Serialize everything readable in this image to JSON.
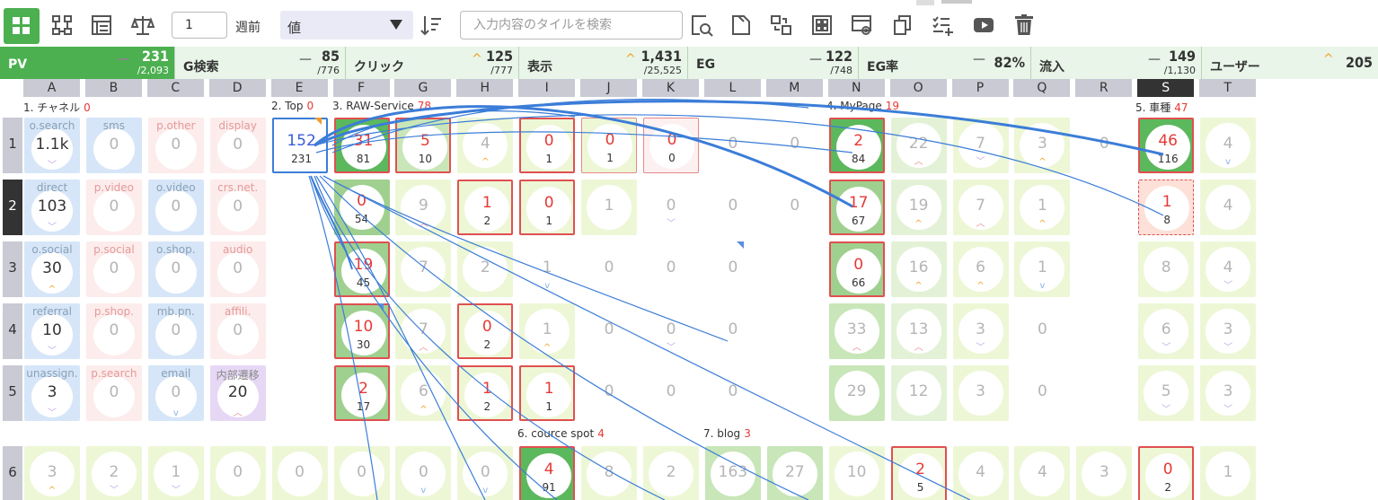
{
  "toolbar": {
    "weeks_value": "1",
    "weeks_label": "週前",
    "metric_select": "値",
    "search_placeholder": "入力内容のタイルを検索",
    "icons": [
      "grid-icon",
      "hierarchy-icon",
      "list-icon",
      "balance-icon",
      "sort-icon",
      "find-icon",
      "document-icon",
      "transfer-icon",
      "tiles-icon",
      "preview-icon",
      "copy-icon",
      "add-checklist-icon",
      "video-icon",
      "trash-icon"
    ]
  },
  "metrics": [
    {
      "label": "PV",
      "value": "231",
      "total": "/2,093",
      "trend": "flat"
    },
    {
      "label": "G検索",
      "value": "85",
      "total": "/776",
      "trend": "flat"
    },
    {
      "label": "クリック",
      "value": "125",
      "total": "/777",
      "trend": "up"
    },
    {
      "label": "表示",
      "value": "1,431",
      "total": "/25,525",
      "trend": "up"
    },
    {
      "label": "EG",
      "value": "122",
      "total": "/748",
      "trend": "flat"
    },
    {
      "label": "EG率",
      "value": "82%",
      "total": "",
      "trend": "flat"
    },
    {
      "label": "流入",
      "value": "149",
      "total": "/1,130",
      "trend": "flat"
    },
    {
      "label": "ユーザー",
      "value": "205",
      "total": "",
      "trend": "up"
    }
  ],
  "columns": [
    "A",
    "B",
    "C",
    "D",
    "E",
    "F",
    "G",
    "H",
    "I",
    "J",
    "K",
    "L",
    "M",
    "N",
    "O",
    "P",
    "Q",
    "R",
    "S",
    "T"
  ],
  "active_column": "S",
  "rows": [
    "1",
    "2",
    "3",
    "4",
    "5",
    "6"
  ],
  "active_row": "2",
  "groups": [
    {
      "name": "1. チャネル",
      "count": "0"
    },
    {
      "name": "2. Top",
      "count": "0"
    },
    {
      "name": "3. RAW-Service",
      "count": "78"
    },
    {
      "name": "4. MyPage",
      "count": "19"
    },
    {
      "name": "5. 車種",
      "count": "47"
    },
    {
      "name": "6. cource spot",
      "count": "4"
    },
    {
      "name": "7. blog",
      "count": "3"
    }
  ],
  "colors": {
    "accent_green": "#4caf50",
    "alert_red": "#e53935",
    "link_blue": "#3b7dd8"
  },
  "cells": [
    {
      "col": 0,
      "row": 0,
      "title": "o.search",
      "value": "1.1k",
      "bg": "blue",
      "caret": "dn2"
    },
    {
      "col": 1,
      "row": 0,
      "title": "sms",
      "value": "0",
      "bg": "blue",
      "faded": true
    },
    {
      "col": 2,
      "row": 0,
      "title": "p.other",
      "value": "0",
      "bg": "pink",
      "faded": true
    },
    {
      "col": 3,
      "row": 0,
      "title": "display",
      "value": "0",
      "bg": "pink",
      "faded": true
    },
    {
      "col": 0,
      "row": 1,
      "title": "direct",
      "value": "103",
      "bg": "blue",
      "caret": "dn2"
    },
    {
      "col": 1,
      "row": 1,
      "title": "p.video",
      "value": "0",
      "bg": "pink",
      "faded": true
    },
    {
      "col": 2,
      "row": 1,
      "title": "o.video",
      "value": "0",
      "bg": "blue",
      "faded": true
    },
    {
      "col": 3,
      "row": 1,
      "title": "crs.net.",
      "value": "0",
      "bg": "pink",
      "faded": true
    },
    {
      "col": 0,
      "row": 2,
      "title": "o.social",
      "value": "30",
      "bg": "blue",
      "caret": "up"
    },
    {
      "col": 1,
      "row": 2,
      "title": "p.social",
      "value": "0",
      "bg": "pink",
      "faded": true
    },
    {
      "col": 2,
      "row": 2,
      "title": "o.shop.",
      "value": "0",
      "bg": "blue",
      "faded": true
    },
    {
      "col": 3,
      "row": 2,
      "title": "audio",
      "value": "0",
      "bg": "pink",
      "faded": true
    },
    {
      "col": 0,
      "row": 3,
      "title": "referral",
      "value": "10",
      "bg": "blue",
      "caret": "dn2"
    },
    {
      "col": 1,
      "row": 3,
      "title": "p.shop.",
      "value": "0",
      "bg": "pink",
      "faded": true
    },
    {
      "col": 2,
      "row": 3,
      "title": "mb.pn.",
      "value": "0",
      "bg": "blue",
      "faded": true
    },
    {
      "col": 3,
      "row": 3,
      "title": "affili.",
      "value": "0",
      "bg": "pink",
      "faded": true
    },
    {
      "col": 0,
      "row": 4,
      "title": "unassign.",
      "value": "3",
      "bg": "blue",
      "caret": "dn2"
    },
    {
      "col": 1,
      "row": 4,
      "title": "p.search",
      "value": "0",
      "bg": "pink",
      "faded": true
    },
    {
      "col": 2,
      "row": 4,
      "title": "email",
      "value": "0",
      "bg": "blue",
      "caret": "dn",
      "faded": true
    },
    {
      "col": 3,
      "row": 4,
      "title": "内部遷移",
      "value": "20",
      "bg": "purple",
      "caret": "up2"
    },
    {
      "col": 4,
      "row": 0,
      "value": "152",
      "sub": "231",
      "bg": "white",
      "border": "blue",
      "valclass": "blue"
    },
    {
      "col": 5,
      "row": 0,
      "value": "31",
      "sub": "81",
      "bg": "green",
      "border": "red",
      "valclass": "red"
    },
    {
      "col": 6,
      "row": 0,
      "value": "5",
      "sub": "10",
      "bg": "lightgreen",
      "border": "red",
      "valclass": "red"
    },
    {
      "col": 7,
      "row": 0,
      "value": "4",
      "bg": "lime",
      "caret": "up",
      "faded": true
    },
    {
      "col": 8,
      "row": 0,
      "value": "0",
      "sub": "1",
      "bg": "lime",
      "border": "red",
      "valclass": "red"
    },
    {
      "col": 9,
      "row": 0,
      "value": "0",
      "sub": "1",
      "bg": "lime",
      "border": "pinkthin",
      "valclass": "red"
    },
    {
      "col": 10,
      "row": 0,
      "value": "0",
      "sub": "0",
      "bg": "ltpink",
      "border": "pinkthin",
      "valclass": "red"
    },
    {
      "col": 11,
      "row": 0,
      "value": "0",
      "bg": "none",
      "faded": true
    },
    {
      "col": 12,
      "row": 0,
      "value": "0",
      "bg": "none",
      "faded": true
    },
    {
      "col": 5,
      "row": 1,
      "value": "0",
      "sub": "54",
      "bg": "midgreen",
      "valclass": "red"
    },
    {
      "col": 6,
      "row": 1,
      "value": "9",
      "bg": "lime",
      "caret": "up2",
      "faded": true
    },
    {
      "col": 7,
      "row": 1,
      "value": "1",
      "sub": "2",
      "bg": "lime",
      "border": "red",
      "valclass": "red"
    },
    {
      "col": 8,
      "row": 1,
      "value": "0",
      "sub": "1",
      "bg": "lime",
      "border": "red",
      "valclass": "red"
    },
    {
      "col": 9,
      "row": 1,
      "value": "1",
      "bg": "lime",
      "faded": true
    },
    {
      "col": 10,
      "row": 1,
      "value": "0",
      "bg": "none",
      "caret": "dn2",
      "faded": true
    },
    {
      "col": 11,
      "row": 1,
      "value": "0",
      "bg": "none",
      "faded": true
    },
    {
      "col": 12,
      "row": 1,
      "value": "0",
      "bg": "none",
      "faded": true
    },
    {
      "col": 5,
      "row": 2,
      "value": "19",
      "sub": "45",
      "bg": "midgreen",
      "border": "red",
      "valclass": "red"
    },
    {
      "col": 6,
      "row": 2,
      "value": "7",
      "bg": "lime",
      "faded": true
    },
    {
      "col": 7,
      "row": 2,
      "value": "2",
      "bg": "lime",
      "faded": true
    },
    {
      "col": 8,
      "row": 2,
      "value": "1",
      "bg": "none",
      "caret": "dn",
      "faded": true
    },
    {
      "col": 9,
      "row": 2,
      "value": "0",
      "bg": "none",
      "faded": true
    },
    {
      "col": 10,
      "row": 2,
      "value": "0",
      "bg": "none",
      "faded": true
    },
    {
      "col": 11,
      "row": 2,
      "value": "0",
      "bg": "none",
      "faded": true
    },
    {
      "col": 5,
      "row": 3,
      "value": "10",
      "sub": "30",
      "bg": "midgreen",
      "border": "red",
      "valclass": "red"
    },
    {
      "col": 6,
      "row": 3,
      "value": "7",
      "bg": "lime",
      "caret": "up2",
      "faded": true
    },
    {
      "col": 7,
      "row": 3,
      "value": "0",
      "sub": "2",
      "bg": "lime",
      "border": "red",
      "valclass": "red"
    },
    {
      "col": 8,
      "row": 3,
      "value": "1",
      "bg": "lime",
      "caret": "up",
      "faded": true
    },
    {
      "col": 9,
      "row": 3,
      "value": "0",
      "bg": "none",
      "faded": true
    },
    {
      "col": 10,
      "row": 3,
      "value": "0",
      "bg": "none",
      "caret": "dn2",
      "faded": true
    },
    {
      "col": 11,
      "row": 3,
      "value": "0",
      "bg": "none",
      "faded": true
    },
    {
      "col": 5,
      "row": 4,
      "value": "2",
      "sub": "17",
      "bg": "midgreen",
      "border": "red",
      "valclass": "red"
    },
    {
      "col": 6,
      "row": 4,
      "value": "6",
      "bg": "lime",
      "caret": "up",
      "faded": true
    },
    {
      "col": 7,
      "row": 4,
      "value": "1",
      "sub": "2",
      "bg": "lime",
      "border": "red",
      "valclass": "red"
    },
    {
      "col": 8,
      "row": 4,
      "value": "1",
      "sub": "1",
      "bg": "lime",
      "border": "red",
      "valclass": "red"
    },
    {
      "col": 9,
      "row": 4,
      "value": "0",
      "bg": "none",
      "faded": true
    },
    {
      "col": 10,
      "row": 4,
      "value": "0",
      "bg": "none",
      "faded": true
    },
    {
      "col": 11,
      "row": 4,
      "value": "0",
      "bg": "none",
      "faded": true
    },
    {
      "col": 13,
      "row": 0,
      "value": "2",
      "sub": "84",
      "bg": "green",
      "border": "red",
      "valclass": "red"
    },
    {
      "col": 14,
      "row": 0,
      "value": "22",
      "bg": "lime2",
      "caret": "up2",
      "faded": true
    },
    {
      "col": 15,
      "row": 0,
      "value": "7",
      "bg": "lime",
      "caret": "dn2",
      "faded": true
    },
    {
      "col": 16,
      "row": 0,
      "value": "3",
      "bg": "lime",
      "caret": "up",
      "faded": true
    },
    {
      "col": 17,
      "row": 0,
      "value": "0",
      "bg": "none",
      "faded": true
    },
    {
      "col": 13,
      "row": 1,
      "value": "17",
      "sub": "67",
      "bg": "midgreen",
      "border": "red",
      "valclass": "red"
    },
    {
      "col": 14,
      "row": 1,
      "value": "19",
      "bg": "lime2",
      "caret": "up",
      "faded": true
    },
    {
      "col": 15,
      "row": 1,
      "value": "7",
      "bg": "lime",
      "caret": "up2",
      "faded": true
    },
    {
      "col": 16,
      "row": 1,
      "value": "1",
      "bg": "lime",
      "caret": "up",
      "faded": true
    },
    {
      "col": 13,
      "row": 2,
      "value": "0",
      "sub": "66",
      "bg": "midgreen",
      "border": "red",
      "valclass": "red"
    },
    {
      "col": 14,
      "row": 2,
      "value": "16",
      "bg": "lime2",
      "caret": "up",
      "faded": true
    },
    {
      "col": 15,
      "row": 2,
      "value": "6",
      "bg": "lime",
      "caret": "up",
      "faded": true
    },
    {
      "col": 16,
      "row": 2,
      "value": "1",
      "bg": "lime",
      "caret": "dn",
      "faded": true
    },
    {
      "col": 13,
      "row": 3,
      "value": "33",
      "bg": "lightgreen",
      "caret": "up2",
      "faded": true
    },
    {
      "col": 14,
      "row": 3,
      "value": "13",
      "bg": "lime2",
      "caret": "up2",
      "faded": true
    },
    {
      "col": 15,
      "row": 3,
      "value": "3",
      "bg": "lime",
      "caret": "dn2",
      "faded": true
    },
    {
      "col": 16,
      "row": 3,
      "value": "0",
      "bg": "none",
      "faded": true
    },
    {
      "col": 13,
      "row": 4,
      "value": "29",
      "bg": "lightgreen",
      "faded": true
    },
    {
      "col": 14,
      "row": 4,
      "value": "12",
      "bg": "lime2",
      "faded": true
    },
    {
      "col": 15,
      "row": 4,
      "value": "3",
      "bg": "lime",
      "faded": true
    },
    {
      "col": 16,
      "row": 4,
      "value": "0",
      "bg": "none",
      "faded": true
    },
    {
      "col": 18,
      "row": 0,
      "value": "46",
      "sub": "116",
      "bg": "green",
      "border": "red",
      "valclass": "red"
    },
    {
      "col": 19,
      "row": 0,
      "value": "4",
      "bg": "lime",
      "caret": "dn",
      "faded": true
    },
    {
      "col": 18,
      "row": 1,
      "value": "1",
      "sub": "8",
      "bg": "salmon",
      "border": "reddash",
      "valclass": "red"
    },
    {
      "col": 19,
      "row": 1,
      "value": "4",
      "bg": "lime",
      "faded": true
    },
    {
      "col": 18,
      "row": 2,
      "value": "8",
      "bg": "lime",
      "faded": true
    },
    {
      "col": 19,
      "row": 2,
      "value": "4",
      "bg": "lime",
      "caret": "dn2",
      "faded": true
    },
    {
      "col": 18,
      "row": 3,
      "value": "6",
      "bg": "lime",
      "caret": "dn2",
      "faded": true
    },
    {
      "col": 19,
      "row": 3,
      "value": "3",
      "bg": "lime",
      "caret": "dn2",
      "faded": true
    },
    {
      "col": 18,
      "row": 4,
      "value": "5",
      "bg": "lime",
      "caret": "dn2",
      "faded": true
    },
    {
      "col": 19,
      "row": 4,
      "value": "3",
      "bg": "lime",
      "caret": "dn2",
      "faded": true
    },
    {
      "col": 0,
      "row": 5,
      "value": "3",
      "bg": "lime",
      "caret": "up",
      "faded": true
    },
    {
      "col": 1,
      "row": 5,
      "value": "2",
      "bg": "lime",
      "caret": "dn2",
      "faded": true
    },
    {
      "col": 2,
      "row": 5,
      "value": "1",
      "bg": "lime",
      "caret": "dn2",
      "faded": true
    },
    {
      "col": 3,
      "row": 5,
      "value": "0",
      "bg": "lime",
      "faded": true
    },
    {
      "col": 4,
      "row": 5,
      "value": "0",
      "bg": "lime",
      "faded": true
    },
    {
      "col": 5,
      "row": 5,
      "value": "0",
      "bg": "lime",
      "faded": true
    },
    {
      "col": 6,
      "row": 5,
      "value": "0",
      "bg": "lime",
      "caret": "dn",
      "faded": true
    },
    {
      "col": 7,
      "row": 5,
      "value": "0",
      "bg": "lime",
      "caret": "dn",
      "faded": true
    },
    {
      "col": 8,
      "row": 5,
      "value": "4",
      "sub": "91",
      "bg": "green",
      "border": "red",
      "valclass": "red"
    },
    {
      "col": 9,
      "row": 5,
      "value": "8",
      "bg": "lime",
      "faded": true
    },
    {
      "col": 10,
      "row": 5,
      "value": "2",
      "bg": "lime",
      "faded": true
    },
    {
      "col": 11,
      "row": 5,
      "value": "163",
      "bg": "lightgreen",
      "faded": true
    },
    {
      "col": 12,
      "row": 5,
      "value": "27",
      "bg": "lightgreen",
      "faded": true
    },
    {
      "col": 13,
      "row": 5,
      "value": "10",
      "bg": "lime",
      "faded": true
    },
    {
      "col": 14,
      "row": 5,
      "value": "2",
      "sub": "5",
      "bg": "lime",
      "border": "red",
      "valclass": "red"
    },
    {
      "col": 15,
      "row": 5,
      "value": "4",
      "bg": "lime",
      "faded": true
    },
    {
      "col": 16,
      "row": 5,
      "value": "4",
      "bg": "lime",
      "faded": true
    },
    {
      "col": 17,
      "row": 5,
      "value": "3",
      "bg": "lime",
      "faded": true
    },
    {
      "col": 18,
      "row": 5,
      "value": "0",
      "sub": "2",
      "bg": "lime",
      "border": "red",
      "valclass": "red"
    },
    {
      "col": 19,
      "row": 5,
      "value": "1",
      "bg": "lime",
      "faded": true
    }
  ]
}
